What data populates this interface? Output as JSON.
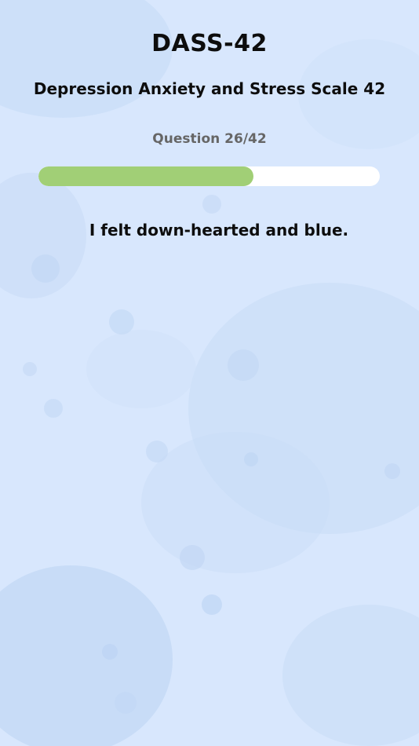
{
  "header": {
    "title": "DASS-42",
    "subtitle": "Depression Anxiety and Stress Scale 42"
  },
  "progress": {
    "label_prefix": "Question",
    "current": "26",
    "total": "42",
    "fraction": 0.631,
    "fill_color": "#a1cf76",
    "track_color": "#ffffff"
  },
  "question": {
    "text": "I felt down-hearted and blue."
  },
  "colors": {
    "background": "#d6e6fc",
    "text": "#0d0d0d",
    "counter_text": "#666666"
  }
}
